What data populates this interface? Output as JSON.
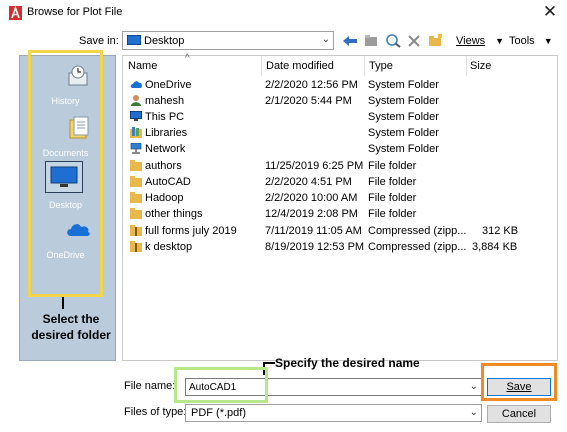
{
  "window": {
    "title": "Browse for Plot File",
    "close_glyph": "✕"
  },
  "toolbar": {
    "save_in_label": "Save in:",
    "location": "Desktop",
    "views_label": "Views",
    "tools_label": "Tools"
  },
  "places": [
    {
      "label": "History",
      "icon": "history-icon"
    },
    {
      "label": "Documents",
      "icon": "documents-icon"
    },
    {
      "label": "Desktop",
      "icon": "desktop-icon"
    },
    {
      "label": "OneDrive",
      "icon": "onedrive-cloud-icon"
    }
  ],
  "columns": {
    "name": "Name",
    "date": "Date modified",
    "type": "Type",
    "size": "Size"
  },
  "files": [
    {
      "name": "OneDrive",
      "date": "2/2/2020 12:56 PM",
      "type": "System Folder",
      "size": "",
      "icon": "onedrive-icon"
    },
    {
      "name": "mahesh",
      "date": "2/1/2020 5:44 PM",
      "type": "System Folder",
      "size": "",
      "icon": "user-icon"
    },
    {
      "name": "This PC",
      "date": "",
      "type": "System Folder",
      "size": "",
      "icon": "computer-icon"
    },
    {
      "name": "Libraries",
      "date": "",
      "type": "System Folder",
      "size": "",
      "icon": "libraries-icon"
    },
    {
      "name": "Network",
      "date": "",
      "type": "System Folder",
      "size": "",
      "icon": "network-icon"
    },
    {
      "name": "authors",
      "date": "11/25/2019 6:25 PM",
      "type": "File folder",
      "size": "",
      "icon": "folder-icon"
    },
    {
      "name": "AutoCAD",
      "date": "2/2/2020 4:51 PM",
      "type": "File folder",
      "size": "",
      "icon": "folder-icon"
    },
    {
      "name": "Hadoop",
      "date": "2/2/2020 10:00 AM",
      "type": "File folder",
      "size": "",
      "icon": "folder-icon"
    },
    {
      "name": "other things",
      "date": "12/4/2019 2:08 PM",
      "type": "File folder",
      "size": "",
      "icon": "folder-icon"
    },
    {
      "name": "full forms july 2019",
      "date": "7/11/2019 11:05 AM",
      "type": "Compressed (zipp...",
      "size": "312 KB",
      "icon": "zip-folder-icon"
    },
    {
      "name": "k desktop",
      "date": "8/19/2019 12:53 PM",
      "type": "Compressed (zipp...",
      "size": "3,884 KB",
      "icon": "zip-folder-icon"
    }
  ],
  "annotations": {
    "select_folder": "Select the desired folder",
    "specify_name": "Specify the desired name"
  },
  "form": {
    "file_name_label": "File name:",
    "file_name_value": "AutoCAD1",
    "file_type_label": "Files of type:",
    "file_type_value": "PDF (*.pdf)",
    "save_label": "Save",
    "cancel_label": "Cancel"
  },
  "colors": {
    "places_bg": "#bacbdc",
    "select_highlight": "#f2d54a",
    "name_highlight": "#b6e88a",
    "save_highlight": "#f08a24",
    "folder": "#e8b94a"
  }
}
